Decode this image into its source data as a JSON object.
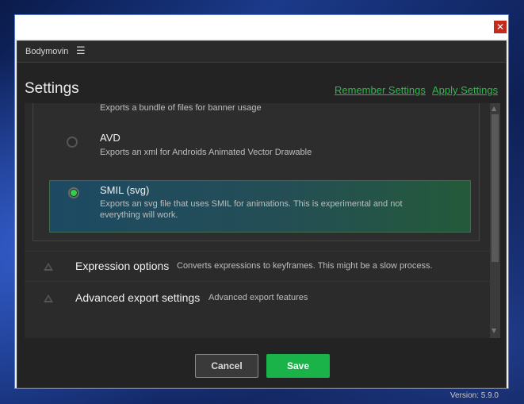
{
  "window": {
    "close_symbol": "✕"
  },
  "topbar": {
    "app_name": "Bodymovin",
    "menu_icon": "☰"
  },
  "header": {
    "title": "Settings",
    "remember_link": "Remember Settings",
    "apply_link": "Apply Settings"
  },
  "formats": {
    "banner_description": "Exports a bundle of files for banner usage",
    "options": [
      {
        "name": "AVD",
        "description": "Exports an xml for Androids Animated Vector Drawable",
        "selected": false
      },
      {
        "name": "SMIL (svg)",
        "description_line1": "Exports an svg file that uses SMIL for animations. This is experimental and not",
        "description_line2": "everything will work.",
        "selected": true
      }
    ]
  },
  "sections": [
    {
      "title": "Expression options",
      "description": "Converts expressions to keyframes. This might be a slow process."
    },
    {
      "title": "Advanced export settings",
      "description": "Advanced export features"
    }
  ],
  "scrollbar": {
    "up_arrow": "▲",
    "down_arrow": "▼"
  },
  "footer": {
    "cancel_label": "Cancel",
    "save_label": "Save",
    "version": "Version: 5.9.0"
  },
  "colors": {
    "accent_green": "#2fb84a",
    "save_button": "#1ab34a",
    "panel_bg": "#232323"
  }
}
